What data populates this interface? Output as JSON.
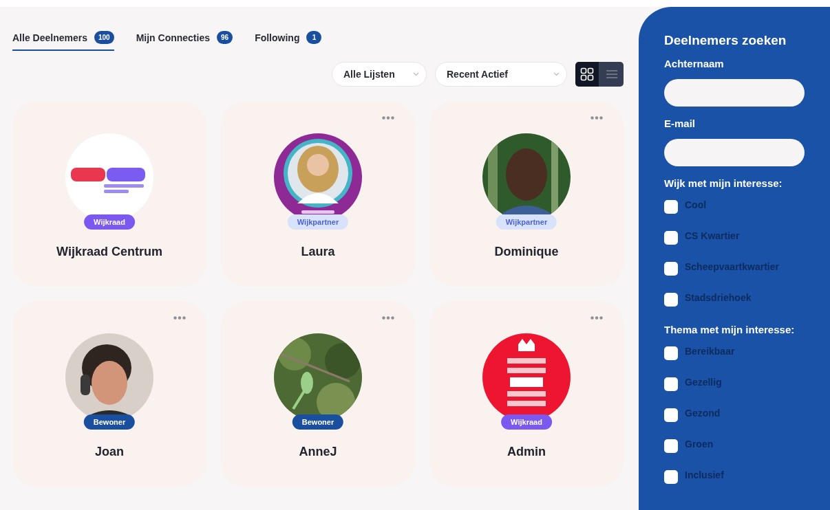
{
  "tabs": [
    {
      "label": "Alle Deelnemers",
      "count": "100",
      "selected": true
    },
    {
      "label": "Mijn Connecties",
      "count": "96",
      "selected": false
    },
    {
      "label": "Following",
      "count": "1",
      "selected": false
    }
  ],
  "filters": [
    {
      "value": "Alle Lijsten"
    },
    {
      "value": "Recent Actief"
    }
  ],
  "view_toggle": [
    {
      "kind": "grid",
      "selected": true
    },
    {
      "kind": "list",
      "selected": false
    }
  ],
  "cards": [
    {
      "name": "Wijkraad Centrum",
      "badge": {
        "label": "Wijkraad",
        "kind": "wijkraad"
      },
      "menu": false
    },
    {
      "name": "Laura",
      "badge": {
        "label": "Wijkpartner",
        "kind": "wijkpartner"
      },
      "menu": true
    },
    {
      "name": "Dominique",
      "badge": {
        "label": "Wijkpartner",
        "kind": "wijkpartner"
      },
      "menu": true
    },
    {
      "name": "Joan",
      "badge": {
        "label": "Bewoner",
        "kind": "bewoner"
      },
      "menu": true
    },
    {
      "name": "AnneJ",
      "badge": {
        "label": "Bewoner",
        "kind": "bewoner"
      },
      "menu": true
    },
    {
      "name": "Admin",
      "badge": {
        "label": "Wijkraad",
        "kind": "wijkraad"
      },
      "menu": true
    }
  ],
  "search_panel": {
    "title": "Deelnemers zoeken",
    "fields": [
      {
        "label": "Achternaam"
      },
      {
        "label": "E-mail"
      }
    ],
    "groups": [
      {
        "title": "Wijk met mijn interesse:",
        "options": [
          {
            "label": "Cool",
            "checked": false
          },
          {
            "label": "CS Kwartier",
            "checked": false
          },
          {
            "label": "Scheepvaartkwartier",
            "checked": false
          },
          {
            "label": "Stadsdriehoek",
            "checked": false
          }
        ]
      },
      {
        "title": "Thema met mijn interesse:",
        "options": [
          {
            "label": "Bereikbaar",
            "checked": false
          },
          {
            "label": "Gezellig",
            "checked": false
          },
          {
            "label": "Gezond",
            "checked": false
          },
          {
            "label": "Groen",
            "checked": false
          },
          {
            "label": "Inclusief",
            "checked": false
          }
        ]
      }
    ]
  }
}
